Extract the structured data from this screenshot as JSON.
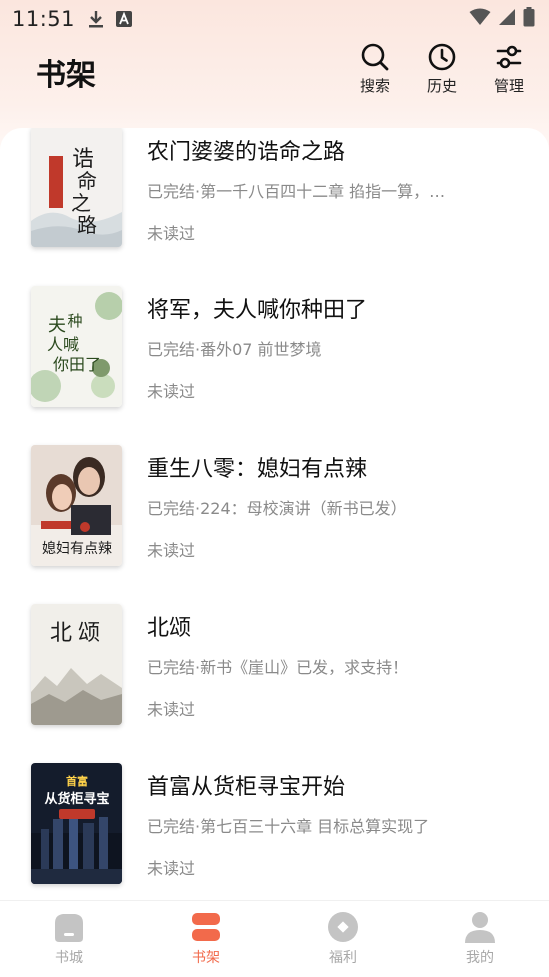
{
  "status_bar": {
    "time": "11:51"
  },
  "header": {
    "title": "书架",
    "actions": [
      {
        "label": "搜索",
        "icon": "search-icon"
      },
      {
        "label": "历史",
        "icon": "clock-icon"
      },
      {
        "label": "管理",
        "icon": "sliders-icon"
      }
    ]
  },
  "books": [
    {
      "title": "农门婆婆的诰命之路",
      "status": "已完结·第一千八百四十二章 掐指一算，…",
      "read_state": "未读过",
      "cover_text": "诰命之路"
    },
    {
      "title": "将军，夫人喊你种田了",
      "status": "已完结·番外07 前世梦境",
      "read_state": "未读过",
      "cover_text": "夫人喊你种田了"
    },
    {
      "title": "重生八零：媳妇有点辣",
      "status": "已完结·224：母校演讲（新书已发）",
      "read_state": "未读过",
      "cover_text": "媳妇有点辣"
    },
    {
      "title": "北颂",
      "status": "已完结·新书《崖山》已发，求支持！",
      "read_state": "未读过",
      "cover_text": "北颂"
    },
    {
      "title": "首富从货柜寻宝开始",
      "status": "已完结·第七百三十六章 目标总算实现了",
      "read_state": "未读过",
      "cover_text": "从货柜寻宝"
    }
  ],
  "bottom_nav": {
    "items": [
      {
        "label": "书城",
        "icon": "store-icon",
        "active": false
      },
      {
        "label": "书架",
        "icon": "bookshelf-icon",
        "active": true
      },
      {
        "label": "福利",
        "icon": "gift-icon",
        "active": false
      },
      {
        "label": "我的",
        "icon": "user-icon",
        "active": false
      }
    ]
  },
  "colors": {
    "accent": "#f26a4b",
    "inactive": "#bdbdbd",
    "muted_text": "#8a8a8a"
  }
}
